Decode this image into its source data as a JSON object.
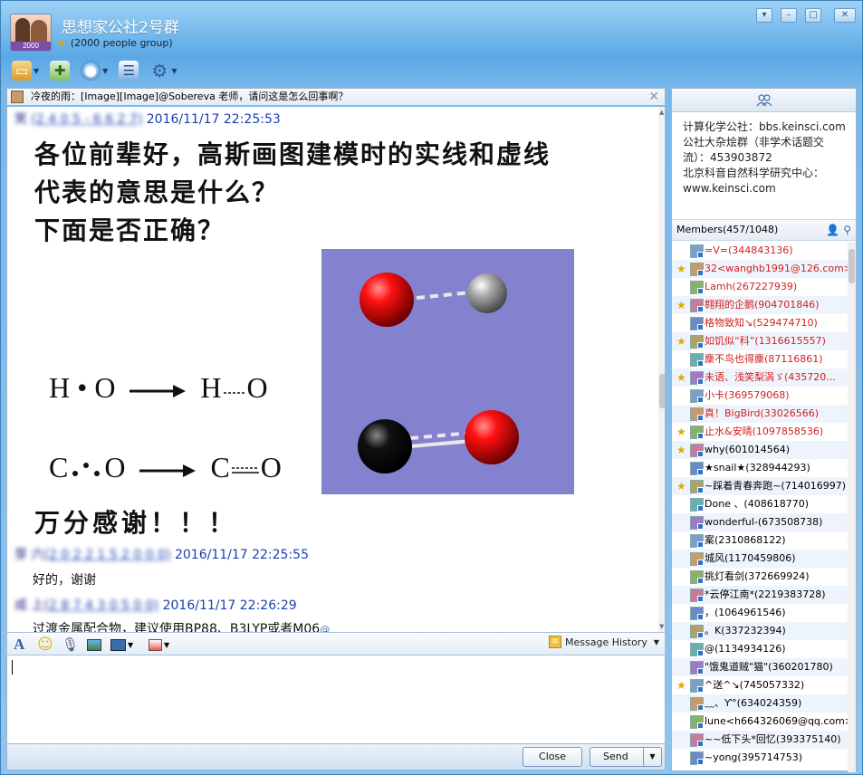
{
  "window": {
    "title": "思想家公社2号群",
    "subtitle": "(2000 people group)",
    "avatar_badge": "2000",
    "colors": {
      "accent": "#5aa8e6",
      "link": "#1a3fb0",
      "member_red": "#d42020"
    }
  },
  "toolbar": {
    "items": [
      {
        "icon": "folder-icon"
      },
      {
        "icon": "add-doc-icon"
      },
      {
        "icon": "eye-icon"
      },
      {
        "icon": "chat-icon"
      },
      {
        "icon": "gear-icon"
      }
    ]
  },
  "notice": {
    "text": "冷夜的雨：[Image][Image]@Sobereva 老师，请问这是怎么回事啊？"
  },
  "messages": [
    {
      "timestamp": "2016/11/17 22:25:53"
    },
    {
      "lines": [
        "各位前辈好，高斯画图建模时的实线和虚线",
        "代表的意思是什么？",
        "下面是否正确？"
      ],
      "equations": [
        "H • O",
        "H",
        "O",
        "C",
        "O",
        "C",
        "O"
      ],
      "thanks": "万分感谢！！！"
    },
    {
      "timestamp": "2016/11/17 22:25:55",
      "text": "好的，谢谢"
    },
    {
      "timestamp": "2016/11/17 22:26:29",
      "text": "过渡金属配合物，建议使用BP88、B3LYP或者M06",
      "mention": "@"
    }
  ],
  "input_bar": {
    "message_history": "Message History"
  },
  "input": {
    "value": ""
  },
  "buttons": {
    "close": "Close",
    "send": "Send"
  },
  "announcement": {
    "lines": [
      "计算化学公社：bbs.keinsci.com",
      "公社大杂烩群（非学术话题交流）：453903872",
      "北京科音自然科学研究中心：www.keinsci.com"
    ]
  },
  "members": {
    "header": "Members(457/1048)",
    "list": [
      {
        "name": "=V=(344843136)",
        "red": true,
        "star": false
      },
      {
        "name": "32<wanghb1991@126.com>",
        "red": true,
        "star": true
      },
      {
        "name": "Lamh(267227939)",
        "red": true,
        "star": false
      },
      {
        "name": "翱翔的企鹅(904701846)",
        "red": true,
        "star": true
      },
      {
        "name": "格物致知↘(529474710)",
        "red": true,
        "star": false
      },
      {
        "name": "如饥似“科”(1316615557)",
        "red": true,
        "star": true
      },
      {
        "name": "麇不鸟也得麇(87116861)",
        "red": true,
        "star": false
      },
      {
        "name": "未语、浅笑梨涡ゞ(435720...",
        "red": true,
        "star": true
      },
      {
        "name": "小卡(369579068)",
        "red": true,
        "star": false
      },
      {
        "name": "真！BigBird(33026566)",
        "red": true,
        "star": false
      },
      {
        "name": "止水&安晴(1097858536)",
        "red": true,
        "star": true
      },
      {
        "name": "why(601014564)",
        "red": false,
        "star": true
      },
      {
        "name": "★snail★(328944293)",
        "red": false,
        "star": false
      },
      {
        "name": "~踩着青春奔跑~(714016997)",
        "red": false,
        "star": true
      },
      {
        "name": "Done 、(408618770)",
        "red": false,
        "star": false
      },
      {
        "name": "wonderful-(673508738)",
        "red": false,
        "star": false
      },
      {
        "name": "案(2310868122)",
        "red": false,
        "star": false
      },
      {
        "name": "城风(1170459806)",
        "red": false,
        "star": false
      },
      {
        "name": "挑灯看剑(372669924)",
        "red": false,
        "star": false
      },
      {
        "name": "*云停江南*(2219383728)",
        "red": false,
        "star": false
      },
      {
        "name": "，(1064961546)",
        "red": false,
        "star": false
      },
      {
        "name": "。K(337232394)",
        "red": false,
        "star": false
      },
      {
        "name": "@(1134934126)",
        "red": false,
        "star": false
      },
      {
        "name": "\"饿鬼道贼\"猫\"(360201780)",
        "red": false,
        "star": false
      },
      {
        "name": "^送^↘(745057332)",
        "red": false,
        "star": true
      },
      {
        "name": "﹏、Ƴ°(634024359)",
        "red": false,
        "star": false
      },
      {
        "name": "lune<h664326069@qq.com>",
        "red": false,
        "star": false
      },
      {
        "name": "~~低下头*回忆(393375140)",
        "red": false,
        "star": false
      },
      {
        "name": "~yong(395714753)",
        "red": false,
        "star": false
      }
    ]
  }
}
